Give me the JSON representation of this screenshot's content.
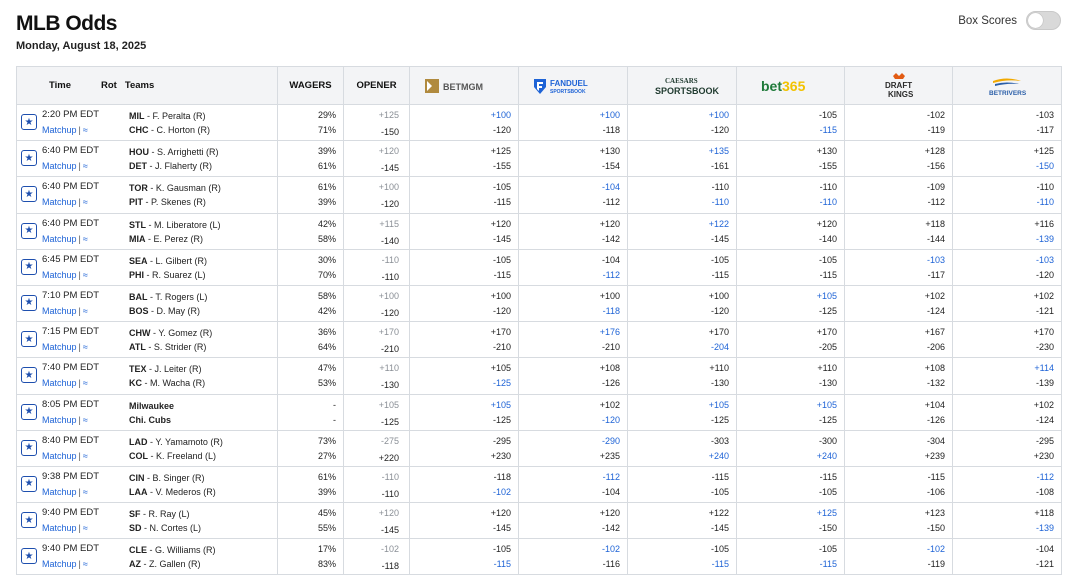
{
  "page": {
    "title": "MLB Odds",
    "date": "Monday, August 18, 2025"
  },
  "box_scores": {
    "label": "Box Scores",
    "enabled": false
  },
  "headers": {
    "time": "Time",
    "rot": "Rot",
    "teams": "Teams",
    "wagers": "WAGERS",
    "opener": "OPENER"
  },
  "books": [
    {
      "key": "betmgm",
      "name": "BETMGM",
      "color": "#b08a3e"
    },
    {
      "key": "fanduel",
      "name": "FANDUEL",
      "sub": "SPORTSBOOK",
      "color": "#1e63d6"
    },
    {
      "key": "caesars",
      "name": "CAESARS",
      "sub": "SPORTSBOOK",
      "color": "#1f3a2f"
    },
    {
      "key": "bet365",
      "name": "bet365",
      "color": "#1f7a3a"
    },
    {
      "key": "draftkings",
      "name": "DRAFT",
      "sub": "KINGS",
      "color": "#e25b13"
    },
    {
      "key": "betrivers",
      "name": "BETRIVERS",
      "color": "#2a5ea8"
    }
  ],
  "matchup_label": "Matchup",
  "games": [
    {
      "time": "2:20 PM EDT",
      "away": {
        "abbr": "MIL",
        "pitcher": "F. Peralta (R)"
      },
      "home": {
        "abbr": "CHC",
        "pitcher": "C. Horton (R)"
      },
      "wagers": [
        "29%",
        "71%"
      ],
      "opener": [
        "+125",
        "-150"
      ],
      "odds": [
        {
          "top": "+100",
          "bot": "-120",
          "hl": "top"
        },
        {
          "top": "+100",
          "bot": "-118",
          "hl": "top"
        },
        {
          "top": "+100",
          "bot": "-120",
          "hl": "top"
        },
        {
          "top": "-105",
          "bot": "-115",
          "hl": "bot"
        },
        {
          "top": "-102",
          "bot": "-119",
          "hl": ""
        },
        {
          "top": "-103",
          "bot": "-117",
          "hl": ""
        }
      ]
    },
    {
      "time": "6:40 PM EDT",
      "away": {
        "abbr": "HOU",
        "pitcher": "S. Arrighetti (R)"
      },
      "home": {
        "abbr": "DET",
        "pitcher": "J. Flaherty (R)"
      },
      "wagers": [
        "39%",
        "61%"
      ],
      "opener": [
        "+120",
        "-145"
      ],
      "odds": [
        {
          "top": "+125",
          "bot": "-155",
          "hl": ""
        },
        {
          "top": "+130",
          "bot": "-154",
          "hl": ""
        },
        {
          "top": "+135",
          "bot": "-161",
          "hl": "top"
        },
        {
          "top": "+130",
          "bot": "-155",
          "hl": ""
        },
        {
          "top": "+128",
          "bot": "-156",
          "hl": ""
        },
        {
          "top": "+125",
          "bot": "-150",
          "hl": "bot"
        }
      ]
    },
    {
      "time": "6:40 PM EDT",
      "away": {
        "abbr": "TOR",
        "pitcher": "K. Gausman (R)"
      },
      "home": {
        "abbr": "PIT",
        "pitcher": "P. Skenes (R)"
      },
      "wagers": [
        "61%",
        "39%"
      ],
      "opener": [
        "+100",
        "-120"
      ],
      "odds": [
        {
          "top": "-105",
          "bot": "-115",
          "hl": ""
        },
        {
          "top": "-104",
          "bot": "-112",
          "hl": "top"
        },
        {
          "top": "-110",
          "bot": "-110",
          "hl": "bot"
        },
        {
          "top": "-110",
          "bot": "-110",
          "hl": "bot"
        },
        {
          "top": "-109",
          "bot": "-112",
          "hl": ""
        },
        {
          "top": "-110",
          "bot": "-110",
          "hl": "bot"
        }
      ]
    },
    {
      "time": "6:40 PM EDT",
      "away": {
        "abbr": "STL",
        "pitcher": "M. Liberatore (L)"
      },
      "home": {
        "abbr": "MIA",
        "pitcher": "E. Perez (R)"
      },
      "wagers": [
        "42%",
        "58%"
      ],
      "opener": [
        "+115",
        "-140"
      ],
      "odds": [
        {
          "top": "+120",
          "bot": "-145",
          "hl": ""
        },
        {
          "top": "+120",
          "bot": "-142",
          "hl": ""
        },
        {
          "top": "+122",
          "bot": "-145",
          "hl": "top"
        },
        {
          "top": "+120",
          "bot": "-140",
          "hl": ""
        },
        {
          "top": "+118",
          "bot": "-144",
          "hl": ""
        },
        {
          "top": "+116",
          "bot": "-139",
          "hl": "bot"
        }
      ]
    },
    {
      "time": "6:45 PM EDT",
      "away": {
        "abbr": "SEA",
        "pitcher": "L. Gilbert (R)"
      },
      "home": {
        "abbr": "PHI",
        "pitcher": "R. Suarez (L)"
      },
      "wagers": [
        "30%",
        "70%"
      ],
      "opener": [
        "-110",
        "-110"
      ],
      "odds": [
        {
          "top": "-105",
          "bot": "-115",
          "hl": ""
        },
        {
          "top": "-104",
          "bot": "-112",
          "hl": "bot"
        },
        {
          "top": "-105",
          "bot": "-115",
          "hl": ""
        },
        {
          "top": "-105",
          "bot": "-115",
          "hl": ""
        },
        {
          "top": "-103",
          "bot": "-117",
          "hl": "top"
        },
        {
          "top": "-103",
          "bot": "-120",
          "hl": "top"
        }
      ]
    },
    {
      "time": "7:10 PM EDT",
      "away": {
        "abbr": "BAL",
        "pitcher": "T. Rogers (L)"
      },
      "home": {
        "abbr": "BOS",
        "pitcher": "D. May (R)"
      },
      "wagers": [
        "58%",
        "42%"
      ],
      "opener": [
        "+100",
        "-120"
      ],
      "odds": [
        {
          "top": "+100",
          "bot": "-120",
          "hl": ""
        },
        {
          "top": "+100",
          "bot": "-118",
          "hl": "bot"
        },
        {
          "top": "+100",
          "bot": "-120",
          "hl": ""
        },
        {
          "top": "+105",
          "bot": "-125",
          "hl": "top"
        },
        {
          "top": "+102",
          "bot": "-124",
          "hl": ""
        },
        {
          "top": "+102",
          "bot": "-121",
          "hl": ""
        }
      ]
    },
    {
      "time": "7:15 PM EDT",
      "away": {
        "abbr": "CHW",
        "pitcher": "Y. Gomez (R)"
      },
      "home": {
        "abbr": "ATL",
        "pitcher": "S. Strider (R)"
      },
      "wagers": [
        "36%",
        "64%"
      ],
      "opener": [
        "+170",
        "-210"
      ],
      "odds": [
        {
          "top": "+170",
          "bot": "-210",
          "hl": ""
        },
        {
          "top": "+176",
          "bot": "-210",
          "hl": "top"
        },
        {
          "top": "+170",
          "bot": "-204",
          "hl": "bot"
        },
        {
          "top": "+170",
          "bot": "-205",
          "hl": ""
        },
        {
          "top": "+167",
          "bot": "-206",
          "hl": ""
        },
        {
          "top": "+170",
          "bot": "-230",
          "hl": ""
        }
      ]
    },
    {
      "time": "7:40 PM EDT",
      "away": {
        "abbr": "TEX",
        "pitcher": "J. Leiter (R)"
      },
      "home": {
        "abbr": "KC",
        "pitcher": "M. Wacha (R)"
      },
      "wagers": [
        "47%",
        "53%"
      ],
      "opener": [
        "+110",
        "-130"
      ],
      "odds": [
        {
          "top": "+105",
          "bot": "-125",
          "hl": "bot"
        },
        {
          "top": "+108",
          "bot": "-126",
          "hl": ""
        },
        {
          "top": "+110",
          "bot": "-130",
          "hl": ""
        },
        {
          "top": "+110",
          "bot": "-130",
          "hl": ""
        },
        {
          "top": "+108",
          "bot": "-132",
          "hl": ""
        },
        {
          "top": "+114",
          "bot": "-139",
          "hl": "top"
        }
      ]
    },
    {
      "time": "8:05 PM EDT",
      "away": {
        "abbr": "Milwaukee",
        "pitcher": ""
      },
      "home": {
        "abbr": "Chi. Cubs",
        "pitcher": ""
      },
      "wagers": [
        "-",
        "-"
      ],
      "opener": [
        "+105",
        "-125"
      ],
      "odds": [
        {
          "top": "+105",
          "bot": "-125",
          "hl": "top"
        },
        {
          "top": "+102",
          "bot": "-120",
          "hl": "bot"
        },
        {
          "top": "+105",
          "bot": "-125",
          "hl": "top"
        },
        {
          "top": "+105",
          "bot": "-125",
          "hl": "top"
        },
        {
          "top": "+104",
          "bot": "-126",
          "hl": ""
        },
        {
          "top": "+102",
          "bot": "-124",
          "hl": ""
        }
      ]
    },
    {
      "time": "8:40 PM EDT",
      "away": {
        "abbr": "LAD",
        "pitcher": "Y. Yamamoto (R)"
      },
      "home": {
        "abbr": "COL",
        "pitcher": "K. Freeland (L)"
      },
      "wagers": [
        "73%",
        "27%"
      ],
      "opener": [
        "-275",
        "+220"
      ],
      "odds": [
        {
          "top": "-295",
          "bot": "+230",
          "hl": ""
        },
        {
          "top": "-290",
          "bot": "+235",
          "hl": "top"
        },
        {
          "top": "-303",
          "bot": "+240",
          "hl": "bot"
        },
        {
          "top": "-300",
          "bot": "+240",
          "hl": "bot"
        },
        {
          "top": "-304",
          "bot": "+239",
          "hl": ""
        },
        {
          "top": "-295",
          "bot": "+230",
          "hl": ""
        }
      ]
    },
    {
      "time": "9:38 PM EDT",
      "away": {
        "abbr": "CIN",
        "pitcher": "B. Singer (R)"
      },
      "home": {
        "abbr": "LAA",
        "pitcher": "V. Mederos (R)"
      },
      "wagers": [
        "61%",
        "39%"
      ],
      "opener": [
        "-110",
        "-110"
      ],
      "odds": [
        {
          "top": "-118",
          "bot": "-102",
          "hl": "bot"
        },
        {
          "top": "-112",
          "bot": "-104",
          "hl": "top"
        },
        {
          "top": "-115",
          "bot": "-105",
          "hl": ""
        },
        {
          "top": "-115",
          "bot": "-105",
          "hl": ""
        },
        {
          "top": "-115",
          "bot": "-106",
          "hl": ""
        },
        {
          "top": "-112",
          "bot": "-108",
          "hl": "top"
        }
      ]
    },
    {
      "time": "9:40 PM EDT",
      "away": {
        "abbr": "SF",
        "pitcher": "R. Ray (L)"
      },
      "home": {
        "abbr": "SD",
        "pitcher": "N. Cortes (L)"
      },
      "wagers": [
        "45%",
        "55%"
      ],
      "opener": [
        "+120",
        "-145"
      ],
      "odds": [
        {
          "top": "+120",
          "bot": "-145",
          "hl": ""
        },
        {
          "top": "+120",
          "bot": "-142",
          "hl": ""
        },
        {
          "top": "+122",
          "bot": "-145",
          "hl": ""
        },
        {
          "top": "+125",
          "bot": "-150",
          "hl": "top"
        },
        {
          "top": "+123",
          "bot": "-150",
          "hl": ""
        },
        {
          "top": "+118",
          "bot": "-139",
          "hl": "bot"
        }
      ]
    },
    {
      "time": "9:40 PM EDT",
      "away": {
        "abbr": "CLE",
        "pitcher": "G. Williams (R)"
      },
      "home": {
        "abbr": "AZ",
        "pitcher": "Z. Gallen (R)"
      },
      "wagers": [
        "17%",
        "83%"
      ],
      "opener": [
        "-102",
        "-118"
      ],
      "odds": [
        {
          "top": "-105",
          "bot": "-115",
          "hl": "bot"
        },
        {
          "top": "-102",
          "bot": "-116",
          "hl": "top"
        },
        {
          "top": "-105",
          "bot": "-115",
          "hl": "bot"
        },
        {
          "top": "-105",
          "bot": "-115",
          "hl": "bot"
        },
        {
          "top": "-102",
          "bot": "-119",
          "hl": "top"
        },
        {
          "top": "-104",
          "bot": "-121",
          "hl": ""
        }
      ]
    }
  ]
}
